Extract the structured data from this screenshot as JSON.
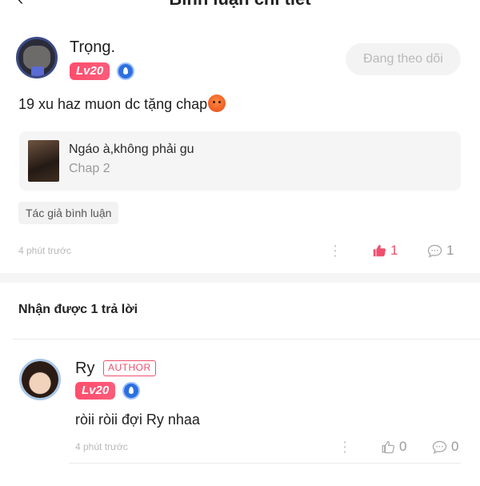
{
  "header": {
    "title": "Bình luận chi tiết"
  },
  "comment": {
    "username": "Trọng.",
    "level": "Lv20",
    "follow_label": "Đang theo dõi",
    "text": "19 xu haz muon dc tặng chap",
    "chapter": {
      "title": "Ngáo à,không phải gu",
      "subtitle": "Chap 2"
    },
    "tag": "Tác giả bình luận",
    "time": "4 phút trước",
    "likes": "1",
    "replies": "1"
  },
  "replies_section": {
    "heading": "Nhận được 1 trả lời"
  },
  "reply": {
    "username": "Ry",
    "author_label": "AUTHOR",
    "level": "Lv20",
    "text": "ròii ròii đợi Ry nhaa",
    "time": "4 phút trước",
    "likes": "0",
    "replies": "0"
  },
  "colors": {
    "accent_pink": "#f0506e",
    "liked_red": "#f0506e",
    "muted_gray": "#b9b9b9"
  }
}
